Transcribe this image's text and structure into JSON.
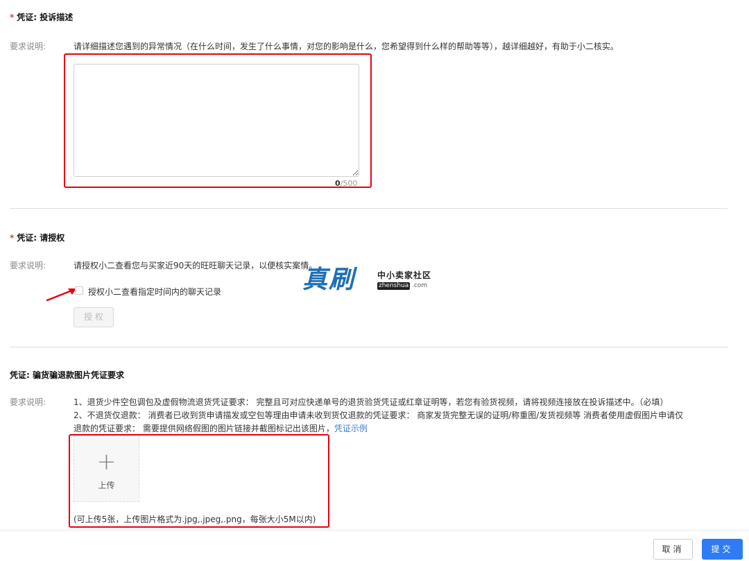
{
  "section1": {
    "required_mark": "*",
    "title": "凭证: 投诉描述",
    "req_label": "要求说明:",
    "req_text": "请详细描述您遇到的异常情况（在什么时间，发生了什么事情，对您的影响是什么，您希望得到什么样的帮助等等），越详细越好，有助于小二核实。",
    "textarea_value": "",
    "counter_current": "0",
    "counter_max": "/500"
  },
  "section2": {
    "required_mark": "*",
    "title": "凭证: 请授权",
    "req_label": "要求说明:",
    "req_text": "请授权小二查看您与买家近90天的旺旺聊天记录，以便核实案情。",
    "checkbox_label": "授权小二查看指定时间内的聊天记录",
    "authorize_button": "授 权"
  },
  "watermark": {
    "main": "真刷",
    "sub": "中小卖家社区",
    "domain_tag": "zhenshua",
    "domain_suffix": ".com"
  },
  "section3": {
    "title": "凭证: 骗货骗退款图片凭证要求",
    "req_label": "要求说明:",
    "line1": "1、退货少件空包调包及虚假物流退货凭证要求：  完整且可对应快递单号的退货验货凭证或红章证明等，若您有验货视频，请将视频连接放在投诉描述中。（必填）",
    "line2": "2、不退货仅退款：  消费者已收到货申请描发或空包等理由申请未收到货仅退款的凭证要求：  商家发货完整无误的证明/称重图/发货视频等 消费者使用虚假图片申请仅",
    "line3": "退款的凭证要求：  需要提供网络假图的图片链接并截图标记出该图片，",
    "example_link": "凭证示例",
    "upload_plus": "+",
    "upload_label": "上传",
    "upload_hint": "(可上传5张，上传图片格式为.jpg,.jpeg,.png，每张大小5M以内)"
  },
  "footer": {
    "cancel": "取消",
    "submit": "提交"
  },
  "colors": {
    "annotation_red": "#e60012",
    "required_red": "#e4393c",
    "link_blue": "#3a7bd5",
    "primary_blue": "#2f7bf5",
    "watermark_blue": "#1f6fb5"
  }
}
